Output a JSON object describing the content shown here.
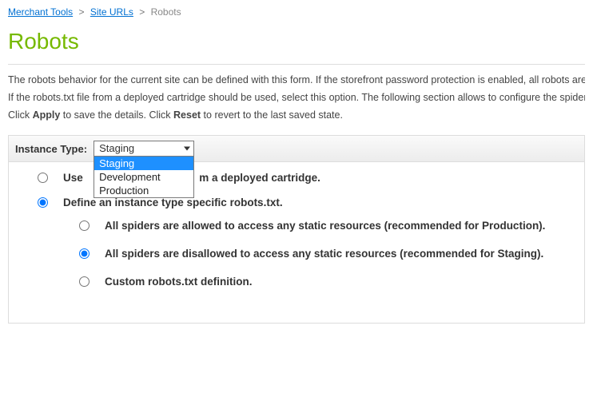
{
  "breadcrumb": {
    "items": [
      {
        "label": "Merchant Tools",
        "link": true
      },
      {
        "label": "Site URLs",
        "link": true
      },
      {
        "label": "Robots",
        "link": false
      }
    ],
    "sep": ">"
  },
  "title": "Robots",
  "intro": {
    "line1_a": "The robots behavior for the current site can be defined with this form. If the storefront password protection is enabled, all robots are disallowed per defa",
    "line2_a": "If the robots.txt file from a deployed cartridge should be used, select this option. The following section allows to configure the spider behavior per instan",
    "line3_a": "Click ",
    "line3_b": "Apply",
    "line3_c": " to save the details. Click ",
    "line3_d": "Reset",
    "line3_e": " to revert to the last saved state."
  },
  "form": {
    "instance_label": "Instance Type:",
    "instance_value": "Staging",
    "instance_options": [
      "Staging",
      "Development",
      "Production"
    ],
    "opt1_a": "Use",
    "opt1_b": "m a deployed cartridge.",
    "opt2": "Define an instance type specific robots.txt.",
    "sub1": "All spiders are allowed to access any static resources (recommended for Production).",
    "sub2": "All spiders are disallowed to access any static resources (recommended for Staging).",
    "sub3": "Custom robots.txt definition."
  }
}
